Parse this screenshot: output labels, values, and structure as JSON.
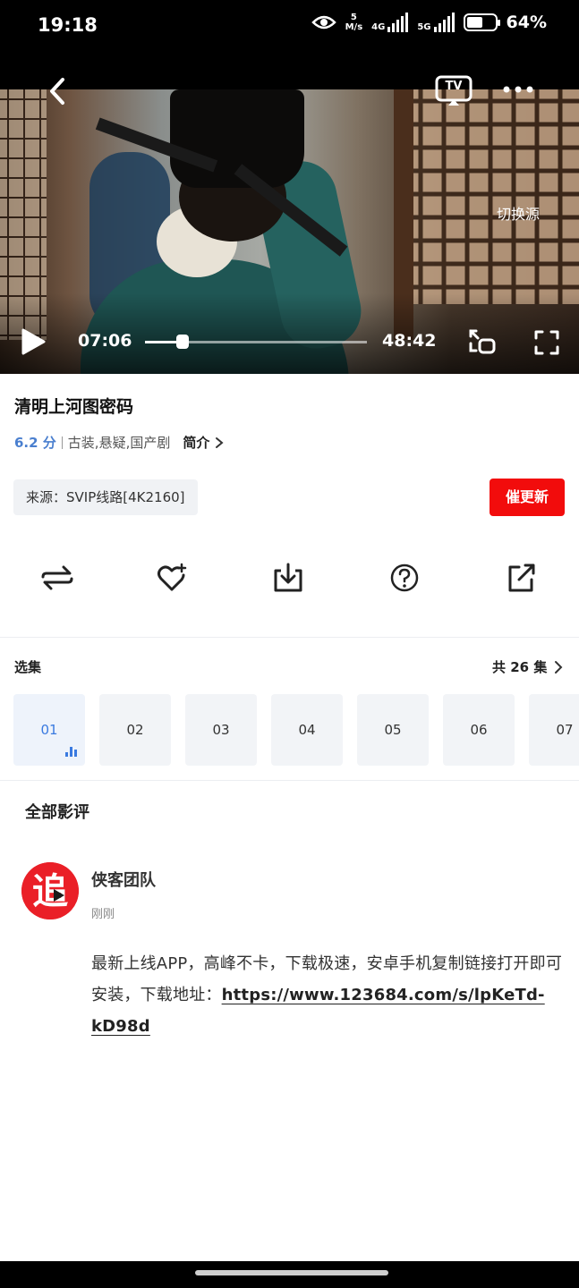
{
  "status_bar": {
    "time": "19:18",
    "net_speed_value": "5",
    "net_speed_unit": "M/s",
    "sim1_label": "4G",
    "sim2_label": "5G",
    "battery_percent": "64%",
    "battery_level": 0.64
  },
  "player": {
    "switch_source_label": "切换源",
    "current_time": "07:06",
    "total_time": "48:42",
    "progress_fraction": 0.17,
    "tv_label": "TV"
  },
  "show": {
    "title": "清明上河图密码",
    "score": "6.2 分",
    "genres": "古装,悬疑,国产剧",
    "intro_label": "简介"
  },
  "source": {
    "label": "来源：SVIP线路[4K2160]",
    "urge_label": "催更新"
  },
  "actions": [
    {
      "icon": "loop-icon"
    },
    {
      "icon": "favorite-add-icon"
    },
    {
      "icon": "download-icon"
    },
    {
      "icon": "help-icon"
    },
    {
      "icon": "share-icon"
    }
  ],
  "episodes": {
    "label": "选集",
    "total_label": "共 26 集",
    "items": [
      "01",
      "02",
      "03",
      "04",
      "05",
      "06",
      "07"
    ],
    "active_index": 0
  },
  "reviews": {
    "header": "全部影评",
    "items": [
      {
        "avatar_glyph": "追",
        "user": "侠客团队",
        "time": "刚刚",
        "text": "最新上线APP，高峰不卡，下载极速，安卓手机复制链接打开即可安装，下载地址：",
        "link": "https://www.123684.com/s/lpKeTd-kD98d"
      }
    ]
  },
  "colors": {
    "accent_blue": "#3a7ae0",
    "score_blue": "#4a7fcf",
    "urge_red": "#f20c0c",
    "avatar_red": "#ea1f27"
  }
}
